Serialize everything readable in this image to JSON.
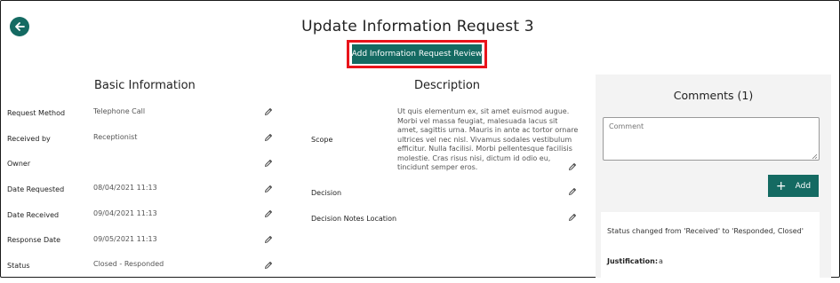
{
  "page": {
    "title": "Update Information Request 3",
    "review_button": "Add Information Request Review"
  },
  "basic_info": {
    "title": "Basic Information",
    "rows": [
      {
        "label": "Request Method",
        "value": "Telephone Call"
      },
      {
        "label": "Received by",
        "value": "Receptionist"
      },
      {
        "label": "Owner",
        "value": ""
      },
      {
        "label": "Date Requested",
        "value": "08/04/2021 11:13"
      },
      {
        "label": "Date Received",
        "value": "09/04/2021 11:13"
      },
      {
        "label": "Response Date",
        "value": "09/05/2021 11:13"
      },
      {
        "label": "Status",
        "value": "Closed - Responded"
      }
    ]
  },
  "description": {
    "title": "Description",
    "scope_label": "Scope",
    "scope_text": "Ut quis elementum ex, sit amet euismod augue. Morbi vel massa feugiat, malesuada lacus sit amet, sagittis urna. Mauris in ante ac tortor ornare ultrices vel nec nisl. Vivamus sodales vestibulum efficitur. Nulla facilisi. Morbi pellentesque facilisis molestie. Cras risus nisi, dictum id odio eu, tincidunt semper eros.",
    "decision_label": "Decision",
    "decision_notes_label": "Decision Notes Location"
  },
  "comments": {
    "title": "Comments (1)",
    "placeholder": "Comment",
    "add_label": "Add",
    "activity_text": "Status changed from 'Received' to 'Responded, Closed'",
    "justification_label": "Justification:",
    "justification_value": "a"
  },
  "colors": {
    "brand": "#146a62",
    "highlight": "#e8141b",
    "panel": "#f3f3f3"
  },
  "icons": {
    "back": "arrow-left-icon",
    "edit": "pencil-icon",
    "add": "plus-icon"
  }
}
